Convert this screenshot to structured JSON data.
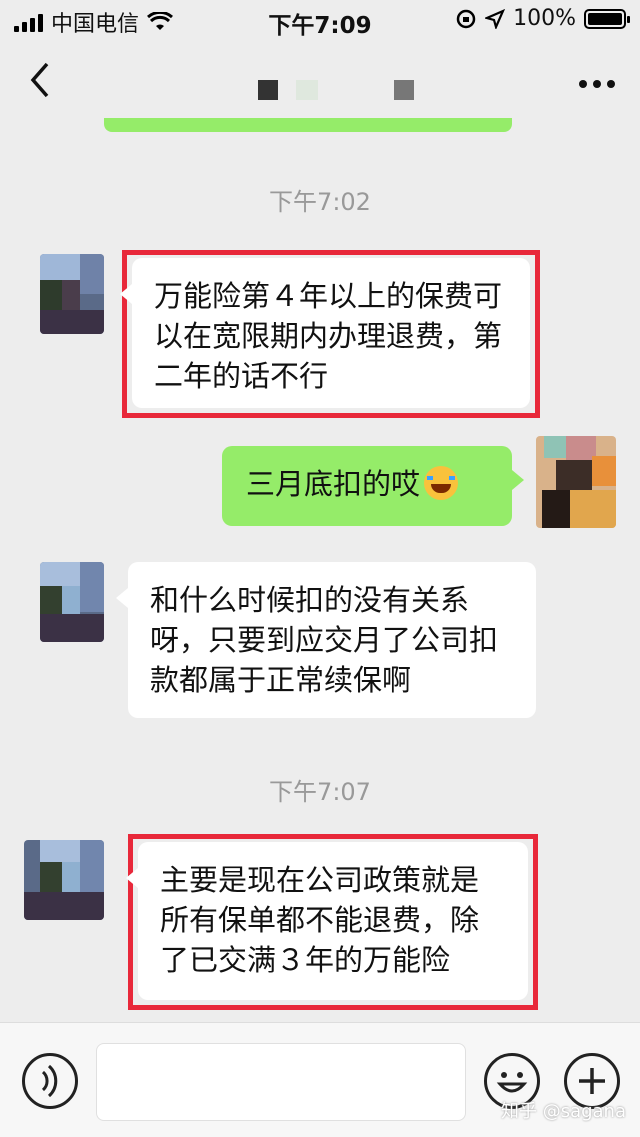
{
  "status_bar": {
    "carrier": "中国电信",
    "time": "下午7:09",
    "battery": "100%",
    "battery_level": 1.0
  },
  "nav": {
    "back_icon": "chevron-left-icon",
    "more_icon": "more-dots-icon"
  },
  "messages": [
    {
      "type": "timestamp",
      "text": "下午7:02"
    },
    {
      "type": "received",
      "highlighted": true,
      "text": "万能险第４年以上的保费可以在宽限期内办理退费，第二年的话不行"
    },
    {
      "type": "sent",
      "highlighted": false,
      "text": "三月底扣的哎",
      "emoji": "tears-of-joy-emoji"
    },
    {
      "type": "received",
      "highlighted": false,
      "text": "和什么时候扣的没有关系呀，只要到应交月了公司扣款都属于正常续保啊"
    },
    {
      "type": "timestamp",
      "text": "下午7:07"
    },
    {
      "type": "received",
      "highlighted": true,
      "text": "主要是现在公司政策就是所有保单都不能退费，除了已交满３年的万能险"
    }
  ],
  "input_bar": {
    "voice_icon": "voice-icon",
    "emoji_icon": "emoji-icon",
    "plus_icon": "plus-icon",
    "placeholder": ""
  },
  "watermark": "知乎 @sagana",
  "colors": {
    "background": "#ededed",
    "sent_bubble": "#95ec69",
    "received_bubble": "#ffffff",
    "highlight_border": "#e8283a",
    "timestamp_text": "#999999"
  }
}
